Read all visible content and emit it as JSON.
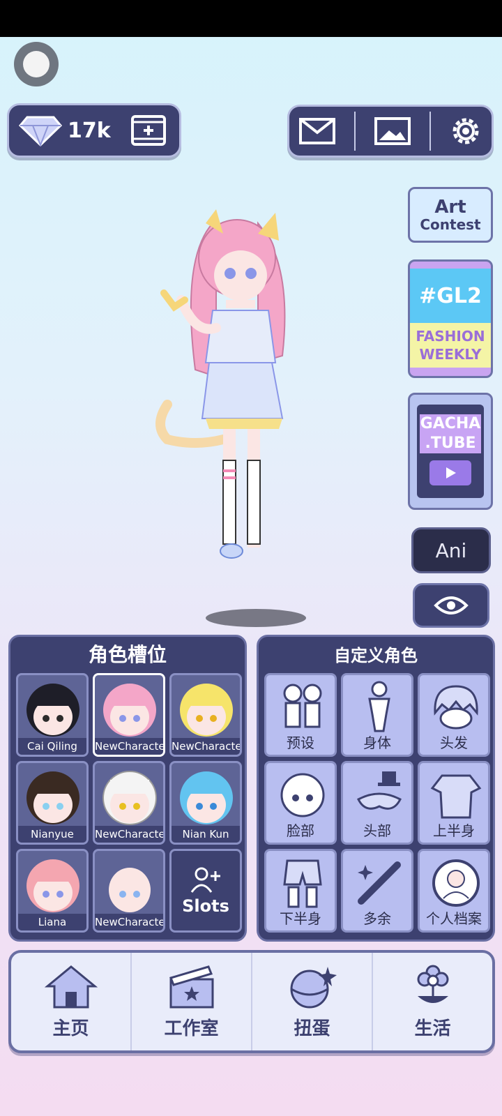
{
  "currency": {
    "gems": "17k"
  },
  "side": {
    "art_contest": {
      "line1": "Art",
      "line2": "Contest"
    },
    "gl2": {
      "tag": "#GL2",
      "line1": "FASHION",
      "line2": "WEEKLY"
    },
    "gacha_tube": {
      "line1": "GACHA",
      "line2": ".TUBE"
    },
    "ani": "Ani"
  },
  "slots_panel": {
    "title": "角色槽位",
    "slots": [
      "Cai Qiling",
      "NewCharacter",
      "NewCharacter",
      "Nianyue",
      "NewCharacter",
      "Nian Kun",
      "Liana",
      "NewCharacter"
    ],
    "add_label": "Slots"
  },
  "custom_panel": {
    "title": "自定义角色",
    "categories": [
      "预设",
      "身体",
      "头发",
      "脸部",
      "头部",
      "上半身",
      "下半身",
      "多余",
      "个人档案"
    ]
  },
  "nav": [
    "主页",
    "工作室",
    "扭蛋",
    "生活"
  ],
  "colors": {
    "panel": "#3d4170",
    "accent": "#b8bef0",
    "pink_hair": "#f4a6c8",
    "yellow_hair": "#f6e46a",
    "blue_hair": "#62c4f0"
  }
}
